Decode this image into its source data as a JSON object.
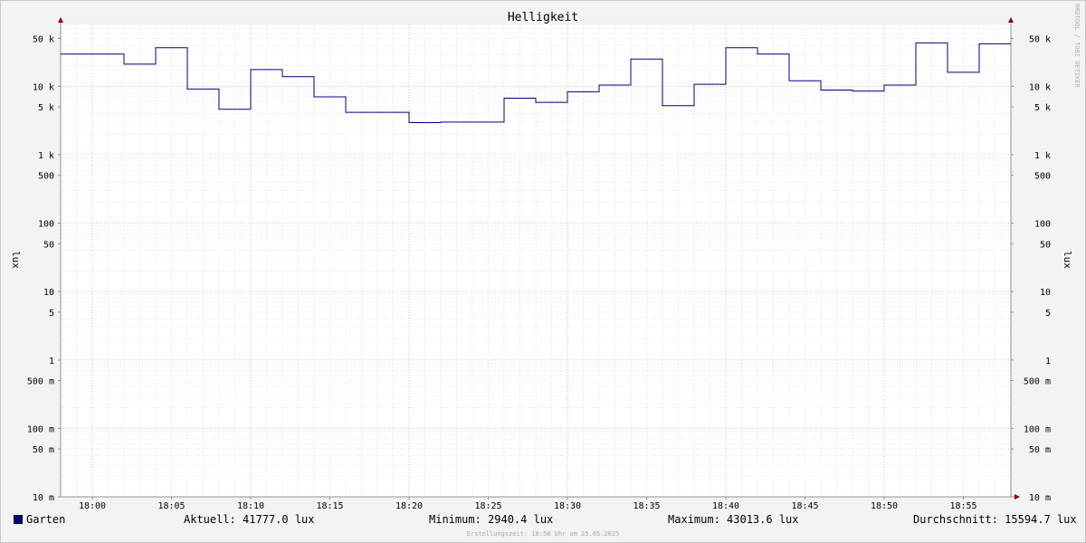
{
  "chart_data": {
    "type": "line",
    "title": "Helligkeit",
    "ylabel": "lux",
    "y_scale": "log",
    "ylim": [
      0.01,
      80000
    ],
    "xlim": [
      "17:58",
      "18:58"
    ],
    "grid": true,
    "y_ticks": [
      {
        "value": 50000,
        "label": "50 k"
      },
      {
        "value": 10000,
        "label": "10 k"
      },
      {
        "value": 5000,
        "label": "5 k"
      },
      {
        "value": 1000,
        "label": "1 k"
      },
      {
        "value": 500,
        "label": "500"
      },
      {
        "value": 100,
        "label": "100"
      },
      {
        "value": 50,
        "label": "50"
      },
      {
        "value": 10,
        "label": "10"
      },
      {
        "value": 5,
        "label": "5"
      },
      {
        "value": 1,
        "label": "1"
      },
      {
        "value": 0.5,
        "label": "500 m"
      },
      {
        "value": 0.1,
        "label": "100 m"
      },
      {
        "value": 0.05,
        "label": "50 m"
      },
      {
        "value": 0.01,
        "label": "10 m"
      }
    ],
    "x_ticks": [
      "18:00",
      "18:05",
      "18:10",
      "18:15",
      "18:20",
      "18:25",
      "18:30",
      "18:35",
      "18:40",
      "18:45",
      "18:50",
      "18:55"
    ],
    "series": [
      {
        "name": "Garten",
        "color": "#000080",
        "x": [
          "17:58",
          "18:02",
          "18:04",
          "18:06",
          "18:08",
          "18:10",
          "18:12",
          "18:14",
          "18:16",
          "18:20",
          "18:22",
          "18:26",
          "18:28",
          "18:30",
          "18:32",
          "18:34",
          "18:36",
          "18:38",
          "18:40",
          "18:42",
          "18:44",
          "18:46",
          "18:48",
          "18:50",
          "18:52",
          "18:54",
          "18:56",
          "18:58"
        ],
        "values": [
          29500,
          21000,
          36500,
          9100,
          4600,
          17500,
          13800,
          7000,
          4150,
          2940,
          3000,
          6700,
          5800,
          8300,
          10400,
          25000,
          5200,
          10700,
          36500,
          29500,
          12000,
          8800,
          8500,
          10400,
          43000,
          16000,
          41800,
          41800
        ]
      }
    ]
  },
  "watermark": "RRDTOOL / TOBI OETIKER",
  "legend": {
    "series_name": "Garten",
    "series_color": "#000080",
    "current": "Aktuell: 41777.0 lux",
    "minimum": "Minimum: 2940.4 lux",
    "maximum": "Maximum: 43013.6 lux",
    "average": "Durchschnitt: 15594.7 lux"
  },
  "footer": "Erstellungszeit: 18:58 Uhr am 25.05.2025"
}
